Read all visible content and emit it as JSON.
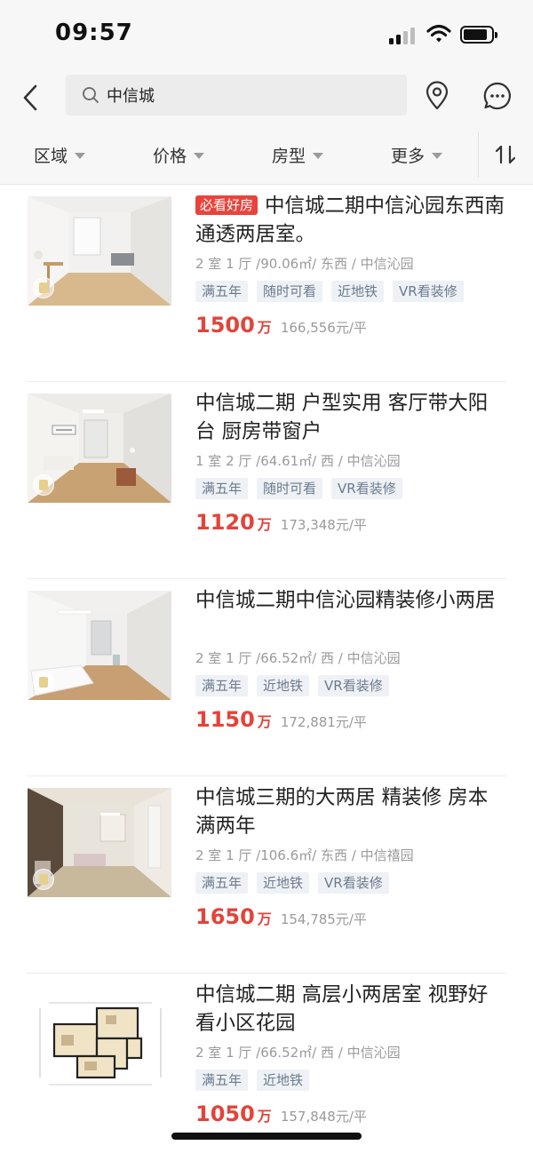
{
  "status_bar": {
    "time": "09:57"
  },
  "nav": {
    "search_text": "中信城",
    "back_icon": "chevron-left-icon",
    "location_icon": "map-pin-icon",
    "message_icon": "chat-bubble-icon"
  },
  "filters": {
    "items": [
      {
        "label": "区域"
      },
      {
        "label": "价格"
      },
      {
        "label": "房型"
      },
      {
        "label": "更多"
      }
    ],
    "sort_icon": "sort-updown-icon"
  },
  "colors": {
    "price_red": "#e4433a",
    "badge_red": "#e9443c",
    "tag_text": "#6c7b8d",
    "tag_bg": "#eef1f5"
  },
  "listings": [
    {
      "badge": "必看好房",
      "title": "中信城二期中信沁园东西南通透两居室。",
      "info": "2 室 1 厅 /90.06㎡/ 东西 / 中信沁园",
      "tags": [
        "满五年",
        "随时可看",
        "近地铁",
        "VR看装修"
      ],
      "price": "1500",
      "price_unit": "万",
      "unit_price": "166,556元/平"
    },
    {
      "title": "中信城二期 户型实用 客厅带大阳台 厨房带窗户",
      "info": "1 室 2 厅 /64.61㎡/ 西 / 中信沁园",
      "tags": [
        "满五年",
        "随时可看",
        "VR看装修"
      ],
      "price": "1120",
      "price_unit": "万",
      "unit_price": "173,348元/平"
    },
    {
      "title": "中信城二期中信沁园精装修小两居",
      "info": "2 室 1 厅 /66.52㎡/ 西 / 中信沁园",
      "tags": [
        "满五年",
        "近地铁",
        "VR看装修"
      ],
      "price": "1150",
      "price_unit": "万",
      "unit_price": "172,881元/平"
    },
    {
      "title": "中信城三期的大两居 精装修 房本满两年",
      "info": "2 室 1 厅 /106.6㎡/ 东西 / 中信禧园",
      "tags": [
        "满五年",
        "近地铁",
        "VR看装修"
      ],
      "price": "1650",
      "price_unit": "万",
      "unit_price": "154,785元/平"
    },
    {
      "title": "中信城二期 高层小两居室 视野好 看小区花园",
      "info": "2 室 1 厅 /66.52㎡/ 西 / 中信沁园",
      "tags": [
        "满五年",
        "近地铁"
      ],
      "price": "1050",
      "price_unit": "万",
      "unit_price": "157,848元/平"
    }
  ]
}
